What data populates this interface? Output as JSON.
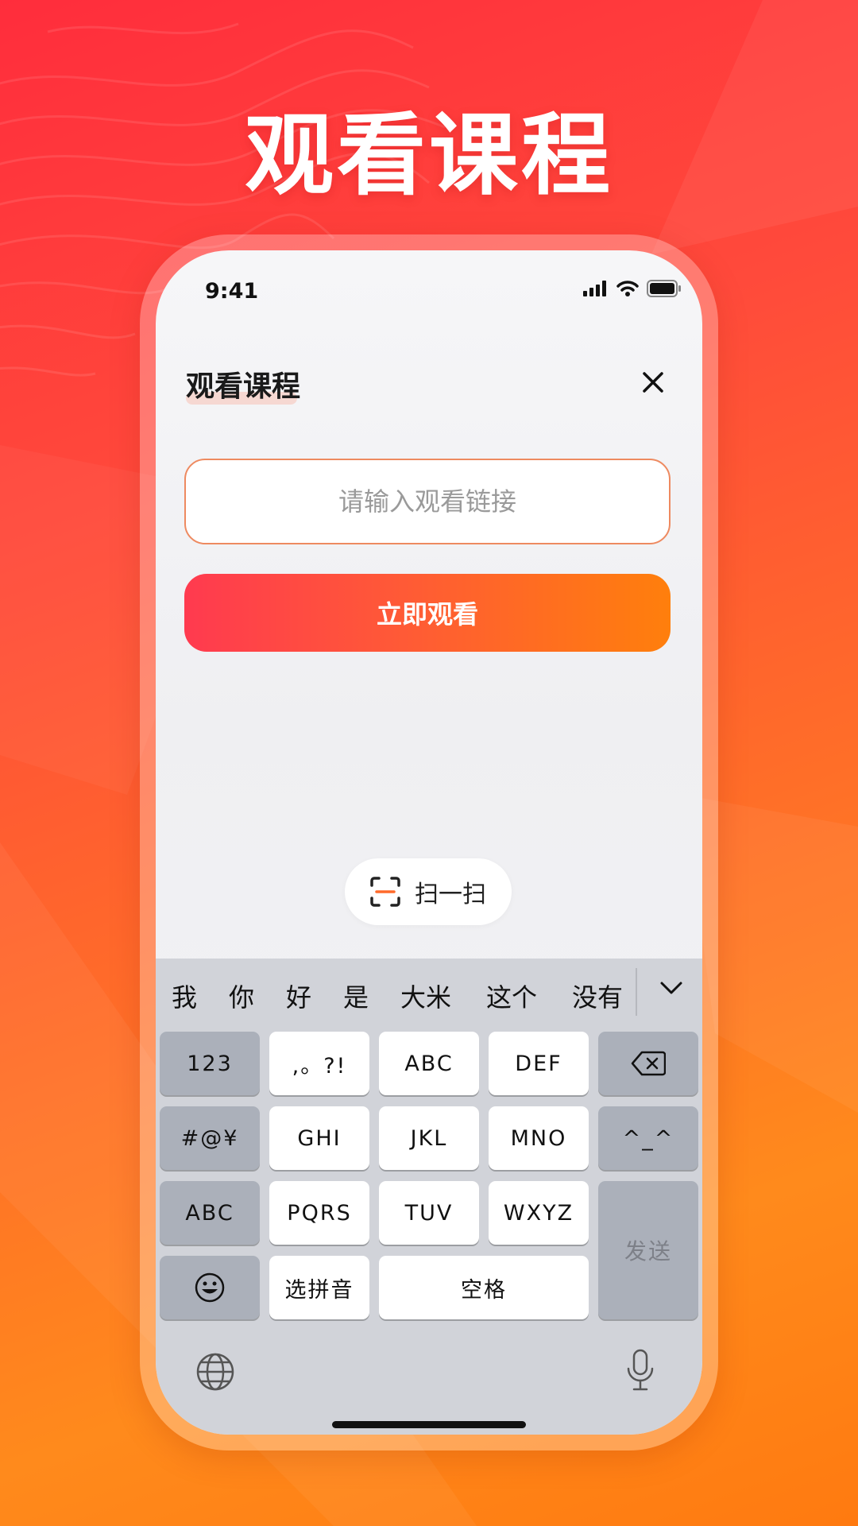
{
  "promo": {
    "title": "观看课程"
  },
  "status_bar": {
    "time": "9:41"
  },
  "sheet": {
    "title": "观看课程",
    "input_placeholder": "请输入观看链接",
    "input_value": "",
    "watch_button": "立即观看",
    "scan_button": "扫一扫"
  },
  "keyboard": {
    "candidates": [
      "我",
      "你",
      "好",
      "是",
      "大米",
      "这个",
      "没有"
    ],
    "keys": {
      "num": "123",
      "punct": ",。?!",
      "abc": "ABC",
      "def": "DEF",
      "symbols": "#@¥",
      "ghi": "GHI",
      "jkl": "JKL",
      "mno": "MNO",
      "emoticon": "^_^",
      "abc_mode": "ABC",
      "pqrs": "PQRS",
      "tuv": "TUV",
      "wxyz": "WXYZ",
      "send": "发送",
      "pinyin": "选拼音",
      "space": "空格"
    }
  },
  "colors": {
    "accent": "#ff5a36",
    "button_start": "#ff3a4f",
    "button_end": "#ff7f0c",
    "scan_accent": "#ff6a2a"
  },
  "icons": [
    "signal-icon",
    "wifi-icon",
    "battery-icon",
    "close-icon",
    "scan-icon",
    "backspace-icon",
    "emoji-icon",
    "globe-icon",
    "microphone-icon",
    "chevron-down-icon"
  ]
}
